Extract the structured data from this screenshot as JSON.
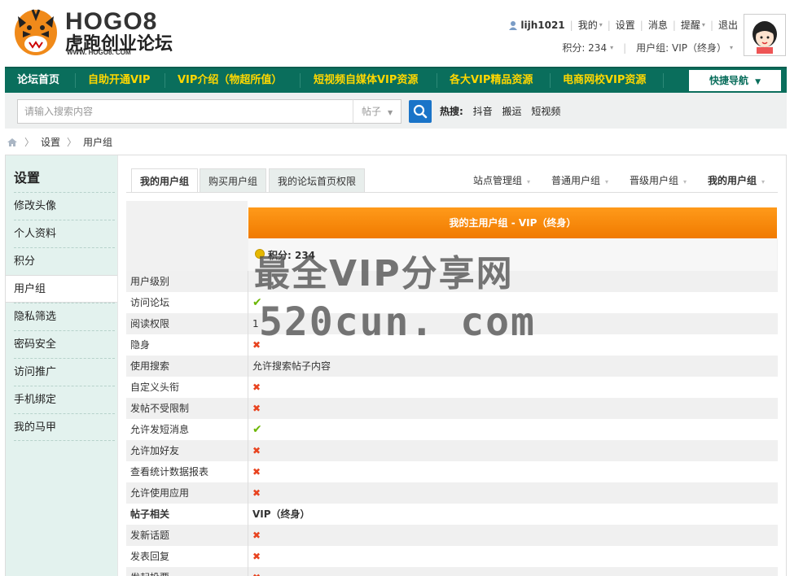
{
  "header": {
    "logo_line1": "HOGO8",
    "logo_line2": "虎跑创业论坛",
    "logo_line3": "WWW. HOGO8. COM",
    "username": "lijh1021",
    "user_links": [
      "我的",
      "设置",
      "消息",
      "提醒",
      "退出"
    ],
    "points": "积分: 234",
    "usergroup": "用户组: VIP（终身）"
  },
  "nav": {
    "items": [
      "论坛首页",
      "自助开通VIP",
      "VIP介绍（物超所值）",
      "短视频自媒体VIP资源",
      "各大VIP精品资源",
      "电商网校VIP资源"
    ],
    "quick": "快捷导航"
  },
  "search": {
    "placeholder": "请输入搜索内容",
    "type": "帖子",
    "hot_label": "热搜:",
    "hot_items": [
      "抖音",
      "搬运",
      "短视频"
    ]
  },
  "breadcrumb": [
    "设置",
    "用户组"
  ],
  "sidebar": {
    "title": "设置",
    "items": [
      "修改头像",
      "个人资料",
      "积分",
      "用户组",
      "隐私筛选",
      "密码安全",
      "访问推广",
      "手机绑定",
      "我的马甲"
    ],
    "active_index": 3
  },
  "tabs": [
    "我的用户组",
    "购买用户组",
    "我的论坛首页权限"
  ],
  "group_links": [
    "站点管理组",
    "普通用户组",
    "晋级用户组",
    "我的用户组"
  ],
  "table": {
    "header": "我的主用户组 - VIP（终身）",
    "points": "积分: 234",
    "rows": [
      {
        "label": "用户级别",
        "value": "",
        "icon": "none"
      },
      {
        "label": "访问论坛",
        "value": "",
        "icon": "check"
      },
      {
        "label": "阅读权限",
        "value": "1",
        "icon": "none"
      },
      {
        "label": "隐身",
        "value": "",
        "icon": "cross"
      },
      {
        "label": "使用搜索",
        "value": "允许搜索帖子内容",
        "icon": "none"
      },
      {
        "label": "自定义头衔",
        "value": "",
        "icon": "cross"
      },
      {
        "label": "发帖不受限制",
        "value": "",
        "icon": "cross"
      },
      {
        "label": "允许发短消息",
        "value": "",
        "icon": "check"
      },
      {
        "label": "允许加好友",
        "value": "",
        "icon": "cross"
      },
      {
        "label": "查看统计数据报表",
        "value": "",
        "icon": "cross"
      },
      {
        "label": "允许使用应用",
        "value": "",
        "icon": "cross"
      },
      {
        "label": "帖子相关",
        "value": "VIP（终身）",
        "icon": "none",
        "bold": true
      },
      {
        "label": "发新话题",
        "value": "",
        "icon": "cross"
      },
      {
        "label": "发表回复",
        "value": "",
        "icon": "cross"
      },
      {
        "label": "发起投票",
        "value": "",
        "icon": "cross"
      }
    ]
  },
  "watermark": {
    "line1": "最全VIP分享网",
    "line2": "520cun. com"
  },
  "colors": {
    "nav_bg": "#0a6e5c",
    "nav_text": "#ffd700",
    "orange": "#f28200",
    "check": "#6bb600",
    "cross": "#e8431f"
  }
}
